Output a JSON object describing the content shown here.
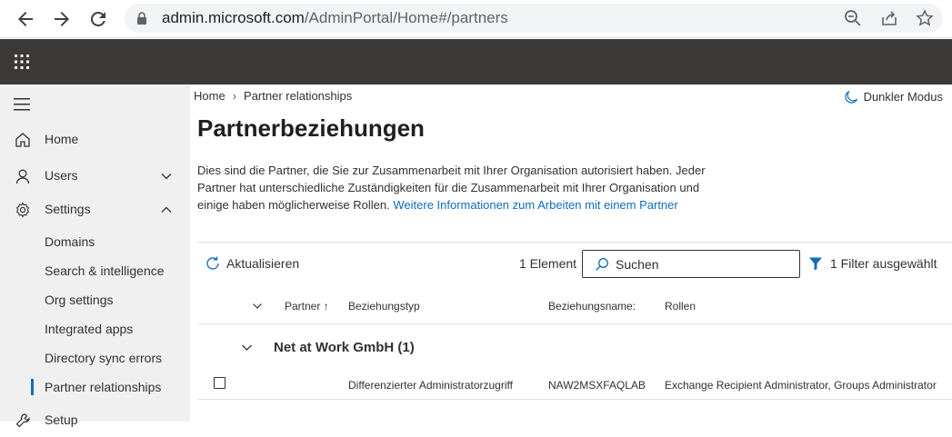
{
  "browser": {
    "url_host": "admin.microsoft.com",
    "url_path": "/AdminPortal/Home#/partners"
  },
  "sidebar": {
    "items": [
      {
        "label": "Home",
        "icon": "home-icon"
      },
      {
        "label": "Users",
        "icon": "person-icon",
        "expanded": false
      },
      {
        "label": "Settings",
        "icon": "gear-icon",
        "expanded": true
      },
      {
        "label": "Setup",
        "icon": "wrench-icon"
      }
    ],
    "settings_children": [
      {
        "label": "Domains"
      },
      {
        "label": "Search & intelligence"
      },
      {
        "label": "Org settings"
      },
      {
        "label": "Integrated apps"
      },
      {
        "label": "Directory sync errors"
      },
      {
        "label": "Partner relationships",
        "active": true
      }
    ]
  },
  "breadcrumb": {
    "home": "Home",
    "current": "Partner relationships"
  },
  "dark_mode_label": "Dunkler Modus",
  "page": {
    "title": "Partnerbeziehungen",
    "description": "Dies sind die Partner, die Sie zur Zusammenarbeit mit Ihrer Organisation autorisiert haben. Jeder Partner hat unterschiedliche Zuständigkeiten für die Zusammenarbeit mit Ihrer Organisation und einige haben möglicherweise Rollen.",
    "learn_more_link": "Weitere Informationen zum Arbeiten mit einem Partner"
  },
  "toolbar": {
    "refresh_label": "Aktualisieren",
    "item_count": "1 Element",
    "search_placeholder": "Suchen",
    "filter_label": "1 Filter ausgewählt"
  },
  "table": {
    "columns": {
      "partner": "Partner ↑",
      "relationship_type": "Beziehungstyp",
      "relationship_name": "Beziehungsname:",
      "roles": "Rollen"
    },
    "groups": [
      {
        "name": "Net at Work GmbH (1)",
        "rows": [
          {
            "partner": "",
            "relationship_type": "Differenzierter Administratorzugriff",
            "relationship_name": "NAW2MSXFAQLAB",
            "roles": "Exchange Recipient Administrator, Groups Administrator"
          }
        ]
      }
    ]
  },
  "colors": {
    "accent": "#0f6cbd",
    "suite_bar": "#3b3a39",
    "sidebar_bg": "#f0f0f0"
  }
}
